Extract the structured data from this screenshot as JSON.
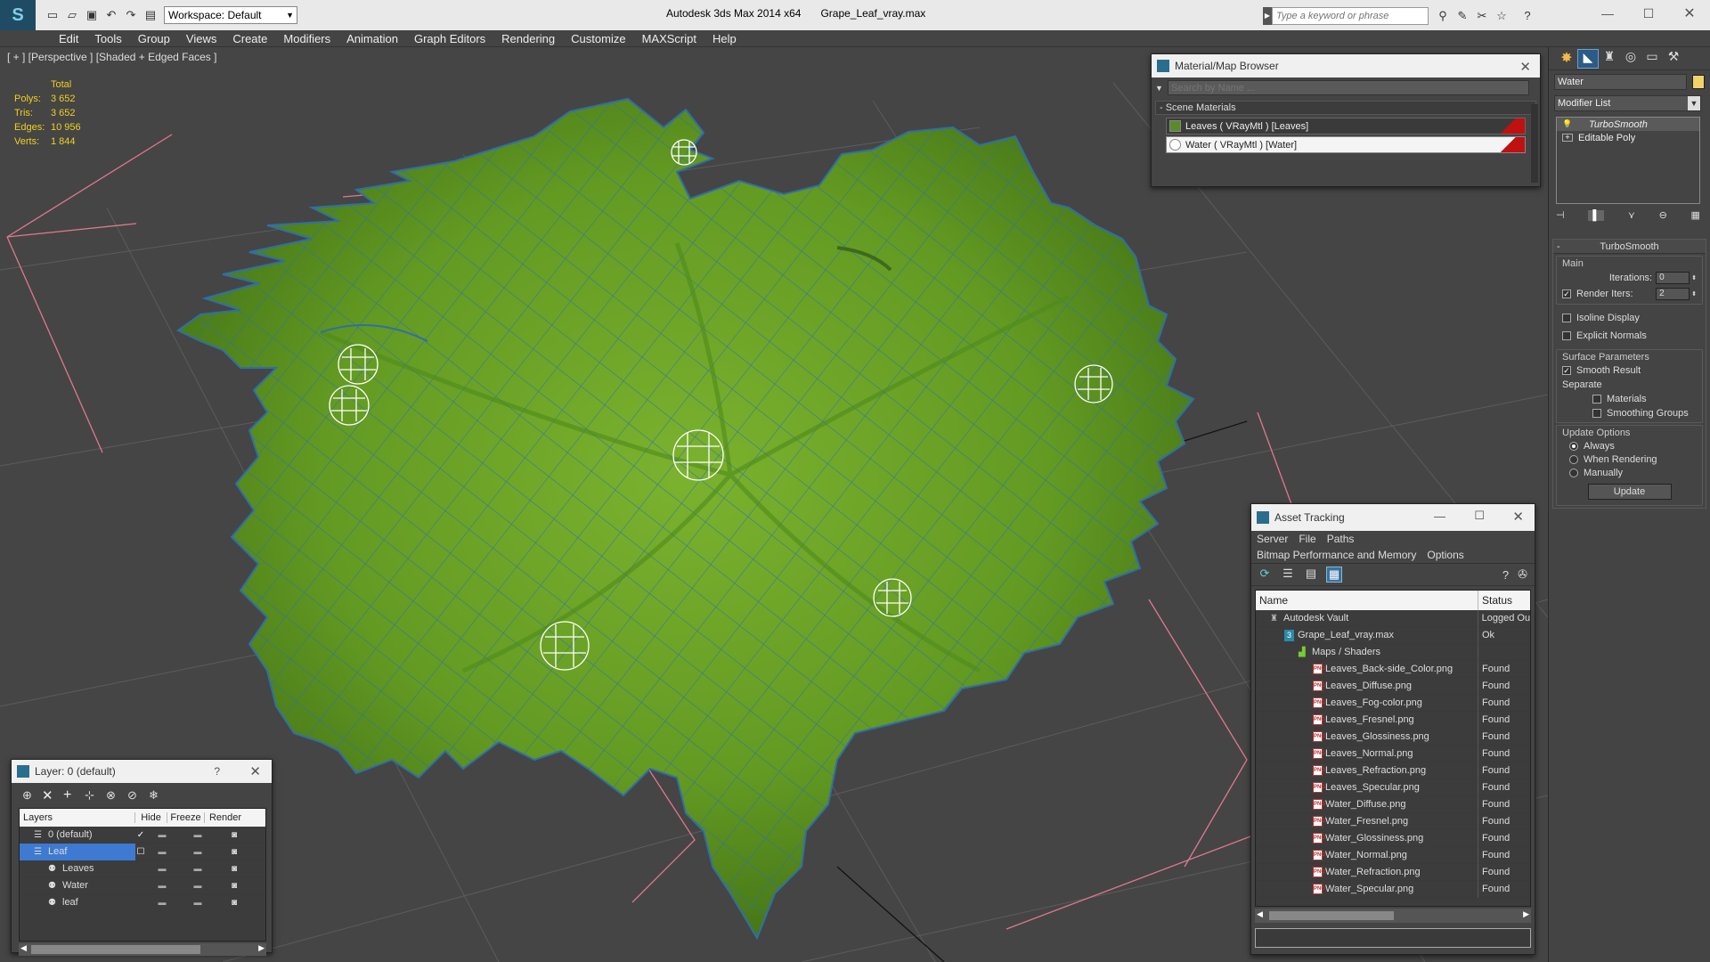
{
  "app": {
    "title_app": "Autodesk 3ds Max  2014 x64",
    "title_file": "Grape_Leaf_vray.max",
    "workspace": "Workspace: Default",
    "search_placeholder": "Type a keyword or phrase"
  },
  "menu": [
    "Edit",
    "Tools",
    "Group",
    "Views",
    "Create",
    "Modifiers",
    "Animation",
    "Graph Editors",
    "Rendering",
    "Customize",
    "MAXScript",
    "Help"
  ],
  "viewport": {
    "label": "[ + ] [Perspective ] [Shaded + Edged Faces ]",
    "stats": {
      "header": "Total",
      "rows": [
        {
          "label": "Polys:",
          "value": "3 652"
        },
        {
          "label": "Tris:",
          "value": "3 652"
        },
        {
          "label": "Edges:",
          "value": "10 956"
        },
        {
          "label": "Verts:",
          "value": "1 844"
        }
      ]
    },
    "colors": {
      "leaf": "#6fa02a",
      "leaf_dark": "#3e6e18",
      "wire": "#2f6fa8",
      "grid": "#5c5c5c",
      "pink": "#e07890"
    }
  },
  "material_browser": {
    "title": "Material/Map Browser",
    "search_placeholder": "Search by Name ...",
    "section": "- Scene Materials",
    "items": [
      {
        "label": "Leaves  ( VRayMtl ) [Leaves]",
        "swatch": "#5a8a2a"
      },
      {
        "label": "Water  ( VRayMtl ) [Water]",
        "swatch": "#ffffff"
      }
    ]
  },
  "command_panel": {
    "object_name": "Water",
    "modifier_list": "Modifier List",
    "stack": [
      "TurboSmooth",
      "Editable Poly"
    ],
    "rollout": "TurboSmooth",
    "main": {
      "title": "Main",
      "iterations_label": "Iterations:",
      "iterations": "0",
      "render_iters_label": "Render Iters:",
      "render_iters": "2"
    },
    "isoline": "Isoline Display",
    "explicit": "Explicit Normals",
    "surface": {
      "title": "Surface Parameters",
      "smooth": "Smooth Result",
      "separate": "Separate",
      "materials": "Materials",
      "smoothing": "Smoothing Groups"
    },
    "update": {
      "title": "Update Options",
      "always": "Always",
      "when_rendering": "When Rendering",
      "manually": "Manually",
      "button": "Update"
    }
  },
  "asset_tracking": {
    "title": "Asset Tracking",
    "menu": [
      "Server",
      "File",
      "Paths"
    ],
    "menu2": [
      "Bitmap Performance and Memory",
      "Options"
    ],
    "columns": [
      "Name",
      "Status"
    ],
    "rows": [
      {
        "name": "Autodesk Vault",
        "status": "Logged Ou",
        "indent": 1,
        "kind": "vault"
      },
      {
        "name": "Grape_Leaf_vray.max",
        "status": "Ok",
        "indent": 2,
        "kind": "max"
      },
      {
        "name": "Maps / Shaders",
        "status": "",
        "indent": 3,
        "kind": "folder"
      },
      {
        "name": "Leaves_Back-side_Color.png",
        "status": "Found",
        "indent": 4,
        "kind": "png"
      },
      {
        "name": "Leaves_Diffuse.png",
        "status": "Found",
        "indent": 4,
        "kind": "png"
      },
      {
        "name": "Leaves_Fog-color.png",
        "status": "Found",
        "indent": 4,
        "kind": "png"
      },
      {
        "name": "Leaves_Fresnel.png",
        "status": "Found",
        "indent": 4,
        "kind": "png"
      },
      {
        "name": "Leaves_Glossiness.png",
        "status": "Found",
        "indent": 4,
        "kind": "png"
      },
      {
        "name": "Leaves_Normal.png",
        "status": "Found",
        "indent": 4,
        "kind": "png"
      },
      {
        "name": "Leaves_Refraction.png",
        "status": "Found",
        "indent": 4,
        "kind": "png"
      },
      {
        "name": "Leaves_Specular.png",
        "status": "Found",
        "indent": 4,
        "kind": "png"
      },
      {
        "name": "Water_Diffuse.png",
        "status": "Found",
        "indent": 4,
        "kind": "png"
      },
      {
        "name": "Water_Fresnel.png",
        "status": "Found",
        "indent": 4,
        "kind": "png"
      },
      {
        "name": "Water_Glossiness.png",
        "status": "Found",
        "indent": 4,
        "kind": "png"
      },
      {
        "name": "Water_Normal.png",
        "status": "Found",
        "indent": 4,
        "kind": "png"
      },
      {
        "name": "Water_Refraction.png",
        "status": "Found",
        "indent": 4,
        "kind": "png"
      },
      {
        "name": "Water_Specular.png",
        "status": "Found",
        "indent": 4,
        "kind": "png"
      }
    ]
  },
  "layer_manager": {
    "title": "Layer: 0 (default)",
    "help": "?",
    "columns": [
      "Layers",
      "Hide",
      "Freeze",
      "Render"
    ],
    "rows": [
      {
        "name": "0 (default)",
        "indent": 1,
        "selected": false,
        "active": true
      },
      {
        "name": "Leaf",
        "indent": 1,
        "selected": true,
        "active": false
      },
      {
        "name": "Leaves",
        "indent": 2,
        "selected": false,
        "active": false
      },
      {
        "name": "Water",
        "indent": 2,
        "selected": false,
        "active": false
      },
      {
        "name": "leaf",
        "indent": 2,
        "selected": false,
        "active": false
      }
    ]
  }
}
